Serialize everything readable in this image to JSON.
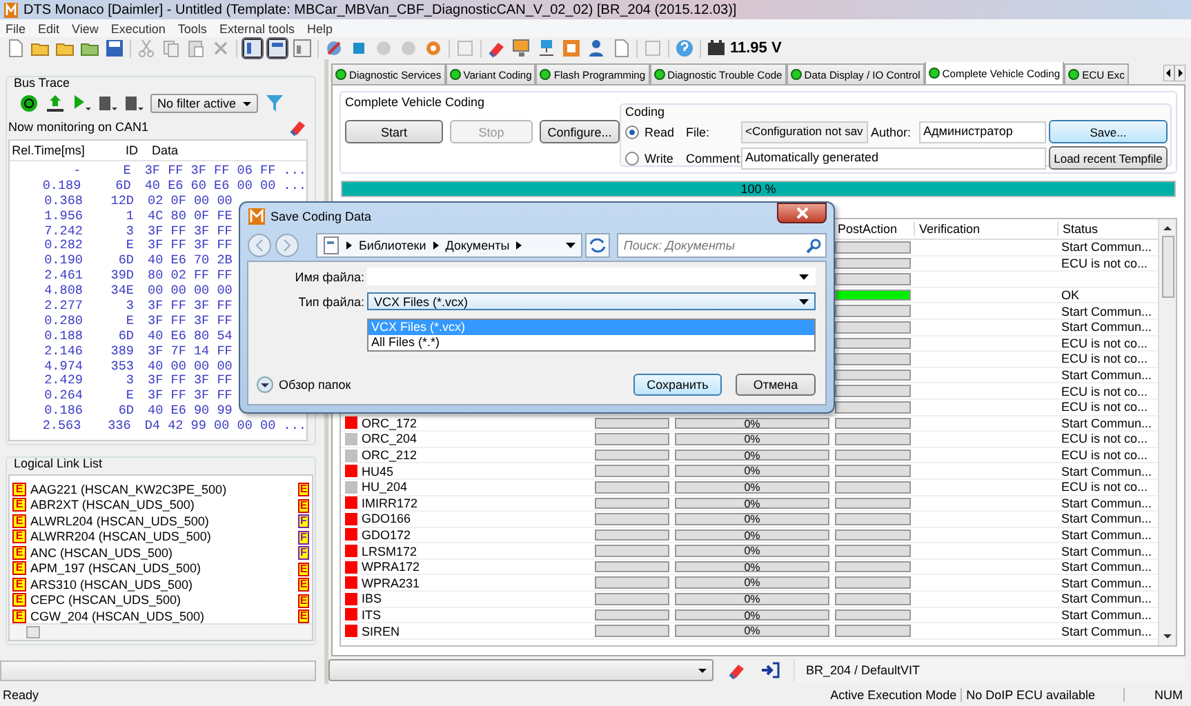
{
  "window": {
    "title": "DTS Monaco [Daimler] - Untitled (Template: MBCar_MBVan_CBF_DiagnosticCAN_V_02_02) [BR_204 (2015.12.03)]"
  },
  "menu": [
    "File",
    "Edit",
    "View",
    "Execution",
    "Tools",
    "External tools",
    "Help"
  ],
  "toolbar": {
    "voltage": "11.95 V"
  },
  "bus_trace": {
    "title": "Bus Trace",
    "filter": "No filter active",
    "monitoring": "Now monitoring on CAN1",
    "columns": [
      "Rel.Time[ms]",
      "ID",
      "Data"
    ],
    "rows": [
      {
        "time": "-",
        "id": "E",
        "data": "3F FF 3F FF 06 FF ..."
      },
      {
        "time": "0.189",
        "id": "6D",
        "data": "40 E6 60 E6 00 00 ..."
      },
      {
        "time": "0.368",
        "id": "12D",
        "data": "02 0F 00 00"
      },
      {
        "time": "1.956",
        "id": "1",
        "data": "4C 80 0F FE"
      },
      {
        "time": "7.242",
        "id": "3",
        "data": "3F FF 3F FF"
      },
      {
        "time": "0.282",
        "id": "E",
        "data": "3F FF 3F FF"
      },
      {
        "time": "0.190",
        "id": "6D",
        "data": "40 E6 70 2B"
      },
      {
        "time": "2.461",
        "id": "39D",
        "data": "80 02 FF FF"
      },
      {
        "time": "4.808",
        "id": "34E",
        "data": "00 00 00 00"
      },
      {
        "time": "2.277",
        "id": "3",
        "data": "3F FF 3F FF"
      },
      {
        "time": "0.280",
        "id": "E",
        "data": "3F FF 3F FF"
      },
      {
        "time": "0.188",
        "id": "6D",
        "data": "40 E6 80 54"
      },
      {
        "time": "2.146",
        "id": "389",
        "data": "3F 7F 14 FF"
      },
      {
        "time": "4.974",
        "id": "353",
        "data": "40 00 00 00"
      },
      {
        "time": "2.429",
        "id": "3",
        "data": "3F FF 3F FF"
      },
      {
        "time": "0.264",
        "id": "E",
        "data": "3F FF 3F FF"
      },
      {
        "time": "0.186",
        "id": "6D",
        "data": "40 E6 90 99"
      },
      {
        "time": "2.563",
        "id": "336",
        "data": "D4 42 99 00 00 00 ..."
      }
    ]
  },
  "logical_link_list": {
    "title": "Logical Link List",
    "items": [
      {
        "badge": "E",
        "label": "AAG221 (HSCAN_KW2C3PE_500)",
        "badge_2": {
          "text": "E",
          "color": "#e00000"
        }
      },
      {
        "badge": "E",
        "label": "ABR2XT (HSCAN_UDS_500)",
        "badge_2": {
          "text": "E",
          "color": "#e00000"
        }
      },
      {
        "badge": "E",
        "label": "ALWRL204 (HSCAN_UDS_500)",
        "badge_2": {
          "text": "F",
          "color": "#8020b0"
        }
      },
      {
        "badge": "E",
        "label": "ALWRR204 (HSCAN_UDS_500)",
        "badge_2": {
          "text": "F",
          "color": "#8020b0"
        }
      },
      {
        "badge": "E",
        "label": "ANC (HSCAN_UDS_500)",
        "badge_2": {
          "text": "F",
          "color": "#8020b0"
        }
      },
      {
        "badge": "E",
        "label": "APM_197 (HSCAN_UDS_500)",
        "badge_2": {
          "text": "E",
          "color": "#e00000"
        }
      },
      {
        "badge": "E",
        "label": "ARS310 (HSCAN_UDS_500)",
        "badge_2": {
          "text": "E",
          "color": "#e00000"
        }
      },
      {
        "badge": "E",
        "label": "CEPC (HSCAN_UDS_500)",
        "badge_2": {
          "text": "E",
          "color": "#e00000"
        }
      },
      {
        "badge": "E",
        "label": "CGW_204 (HSCAN_UDS_500)",
        "badge_2": {
          "text": "E",
          "color": "#e00000"
        }
      }
    ]
  },
  "tabs": [
    {
      "label": "Diagnostic Services",
      "selected": false
    },
    {
      "label": "Variant Coding",
      "selected": false
    },
    {
      "label": "Flash Programming",
      "selected": false
    },
    {
      "label": "Diagnostic Trouble Code",
      "selected": false
    },
    {
      "label": "Data Display / IO Control",
      "selected": false
    },
    {
      "label": "Complete Vehicle Coding",
      "selected": true
    },
    {
      "label": "ECU Exc",
      "selected": false
    }
  ],
  "coding": {
    "group_title": "Complete Vehicle Coding",
    "buttons": [
      {
        "label": "Start",
        "disabled": false
      },
      {
        "label": "Stop",
        "disabled": true
      },
      {
        "label": "Configure...",
        "disabled": false
      }
    ],
    "coding_title": "Coding",
    "modes": [
      {
        "label": "Read",
        "selected": true
      },
      {
        "label": "Write",
        "selected": false
      }
    ],
    "file_label": "File:",
    "file_value": "<Configuration not sav",
    "author_label": "Author:",
    "author_value": "Администратор",
    "comment_label": "Comment:",
    "comment_value": "Automatically generated",
    "actions": [
      {
        "label": "Save...",
        "focused": true
      },
      {
        "label": "Load recent Tempfile",
        "focused": false
      }
    ],
    "progress": {
      "level": 1,
      "reading": "100 %"
    }
  },
  "table": {
    "columns": [
      "PostAction",
      "Verification",
      "Status"
    ],
    "rows": [
      {
        "post_action": {
          "level": 0
        },
        "status": "Start Commun..."
      },
      {
        "post_action": {
          "level": 0
        },
        "status": "ECU is not co..."
      },
      {
        "post_action": {
          "level": 0
        }
      },
      {
        "post_action": {
          "level": 1
        },
        "status": "OK"
      },
      {
        "post_action": {
          "level": 0
        },
        "status": "Start Commun..."
      },
      {
        "post_action": {
          "level": 0
        },
        "status": "Start Commun..."
      },
      {
        "post_action": {
          "level": 0
        },
        "status": "ECU is not co..."
      },
      {
        "post_action": {
          "level": 0
        },
        "status": "ECU is not co..."
      },
      {
        "post_action": {
          "level": 0
        },
        "status": "Start Commun..."
      },
      {
        "post_action": {
          "level": 0
        },
        "status": "ECU is not co..."
      },
      {
        "post_action": {
          "level": 0
        },
        "status": "ECU is not co..."
      },
      {
        "name": "ORC_172",
        "color": "#ff0000",
        "prediction": {
          "level": 0
        },
        "read_write": {
          "level": 0,
          "reading": "0%"
        },
        "post_action": {
          "level": 0
        },
        "status": "Start Commun..."
      },
      {
        "name": "ORC_204",
        "color": "#c0c0c0",
        "prediction": {
          "level": 0
        },
        "read_write": {
          "level": 0,
          "reading": "0%"
        },
        "post_action": {
          "level": 0
        },
        "status": "ECU is not co..."
      },
      {
        "name": "ORC_212",
        "color": "#c0c0c0",
        "prediction": {
          "level": 0
        },
        "read_write": {
          "level": 0,
          "reading": "0%"
        },
        "post_action": {
          "level": 0
        },
        "status": "ECU is not co..."
      },
      {
        "name": "HU45",
        "color": "#ff0000",
        "prediction": {
          "level": 0
        },
        "read_write": {
          "level": 0,
          "reading": "0%"
        },
        "post_action": {
          "level": 0
        },
        "status": "Start Commun..."
      },
      {
        "name": "HU_204",
        "color": "#c0c0c0",
        "prediction": {
          "level": 0
        },
        "read_write": {
          "level": 0,
          "reading": "0%"
        },
        "post_action": {
          "level": 0
        },
        "status": "ECU is not co..."
      },
      {
        "name": "IMIRR172",
        "color": "#ff0000",
        "prediction": {
          "level": 0
        },
        "read_write": {
          "level": 0,
          "reading": "0%"
        },
        "post_action": {
          "level": 0
        },
        "status": "Start Commun..."
      },
      {
        "name": "GDO166",
        "color": "#ff0000",
        "prediction": {
          "level": 0
        },
        "read_write": {
          "level": 0,
          "reading": "0%"
        },
        "post_action": {
          "level": 0
        },
        "status": "Start Commun..."
      },
      {
        "name": "GDO172",
        "color": "#ff0000",
        "prediction": {
          "level": 0
        },
        "read_write": {
          "level": 0,
          "reading": "0%"
        },
        "post_action": {
          "level": 0
        },
        "status": "Start Commun..."
      },
      {
        "name": "LRSM172",
        "color": "#ff0000",
        "prediction": {
          "level": 0
        },
        "read_write": {
          "level": 0,
          "reading": "0%"
        },
        "post_action": {
          "level": 0
        },
        "status": "Start Commun..."
      },
      {
        "name": "WPRA172",
        "color": "#ff0000",
        "prediction": {
          "level": 0
        },
        "read_write": {
          "level": 0,
          "reading": "0%"
        },
        "post_action": {
          "level": 0
        },
        "status": "Start Commun..."
      },
      {
        "name": "WPRA231",
        "color": "#ff0000",
        "prediction": {
          "level": 0
        },
        "read_write": {
          "level": 0,
          "reading": "0%"
        },
        "post_action": {
          "level": 0
        },
        "status": "Start Commun..."
      },
      {
        "name": "IBS",
        "color": "#ff0000",
        "prediction": {
          "level": 0
        },
        "read_write": {
          "level": 0,
          "reading": "0%"
        },
        "post_action": {
          "level": 0
        },
        "status": "Start Commun..."
      },
      {
        "name": "ITS",
        "color": "#ff0000",
        "prediction": {
          "level": 0
        },
        "read_write": {
          "level": 0,
          "reading": "0%"
        },
        "post_action": {
          "level": 0
        },
        "status": "Start Commun..."
      },
      {
        "name": "SIREN",
        "color": "#ff0000",
        "prediction": {
          "level": 0
        },
        "read_write": {
          "level": 0,
          "reading": "0%"
        },
        "post_action": {
          "level": 0
        },
        "status": "Start Commun..."
      }
    ]
  },
  "bottom_bar": {
    "vit": "BR_204 / DefaultVIT"
  },
  "status_bar": [
    "Ready",
    "Active Execution Mode",
    "No DoIP ECU available",
    "NUM"
  ],
  "dialog": {
    "title": "Save Coding Data",
    "path": [
      "Библиотеки",
      "Документы"
    ],
    "search_placeholder": "Поиск: Документы",
    "filename_label": "Имя файла:",
    "filetype_label": "Тип файла:",
    "filetype_value": "VCX Files (*.vcx)",
    "filetype_options": [
      {
        "label": "VCX Files (*.vcx)",
        "selected": true
      },
      {
        "label": "All Files (*.*)",
        "selected": false
      }
    ],
    "browse": "Обзор папок",
    "buttons": [
      {
        "label": "Сохранить",
        "default": true
      },
      {
        "label": "Отмена",
        "default": false
      }
    ]
  }
}
